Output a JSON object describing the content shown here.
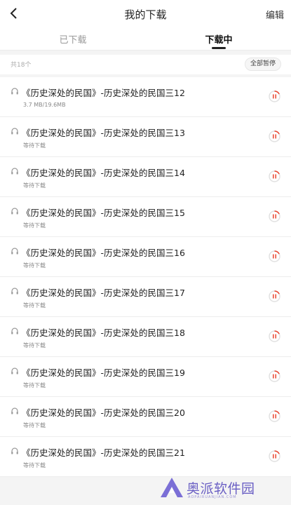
{
  "header": {
    "title": "我的下载",
    "edit_label": "编辑",
    "back_icon": "back-arrow-icon"
  },
  "tabs": [
    {
      "label": "已下载",
      "active": false
    },
    {
      "label": "下载中",
      "active": true
    }
  ],
  "summary": {
    "count_text": "共18个",
    "pause_all_label": "全部暂停"
  },
  "items": [
    {
      "title": "《历史深处的民国》-历史深处的民国三12",
      "status": "3.7 MB/19.6MB"
    },
    {
      "title": "《历史深处的民国》-历史深处的民国三13",
      "status": "等待下载"
    },
    {
      "title": "《历史深处的民国》-历史深处的民国三14",
      "status": "等待下载"
    },
    {
      "title": "《历史深处的民国》-历史深处的民国三15",
      "status": "等待下载"
    },
    {
      "title": "《历史深处的民国》-历史深处的民国三16",
      "status": "等待下载"
    },
    {
      "title": "《历史深处的民国》-历史深处的民国三17",
      "status": "等待下载"
    },
    {
      "title": "《历史深处的民国》-历史深处的民国三18",
      "status": "等待下载"
    },
    {
      "title": "《历史深处的民国》-历史深处的民国三19",
      "status": "等待下载"
    },
    {
      "title": "《历史深处的民国》-历史深处的民国三20",
      "status": "等待下载"
    },
    {
      "title": "《历史深处的民国》-历史深处的民国三21",
      "status": "等待下载"
    }
  ],
  "watermark": {
    "text": "奥派软件园",
    "subtext": "AOPAIRUANJIAN.COM"
  },
  "colors": {
    "accent": "#e8452f",
    "watermark": "#6a5fc4"
  }
}
